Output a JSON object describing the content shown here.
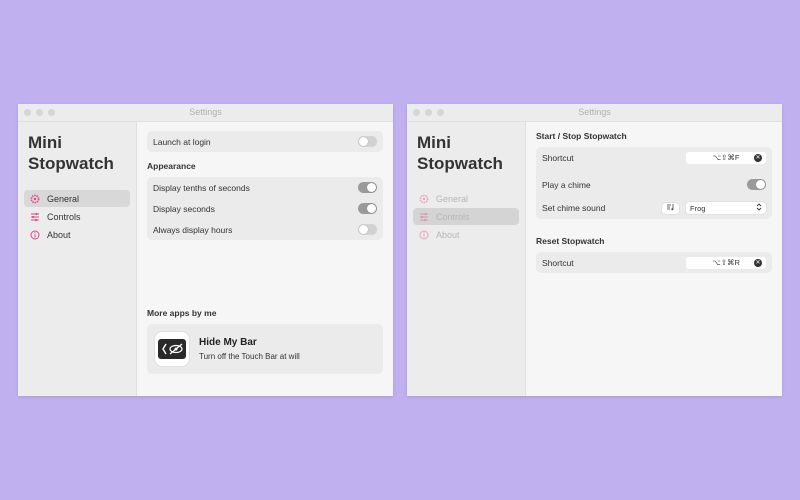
{
  "windows": [
    {
      "title": "Settings",
      "app_title_line1": "Mini",
      "app_title_line2": "Stopwatch",
      "nav": [
        {
          "label": "General",
          "icon": "gear-icon",
          "active": true
        },
        {
          "label": "Controls",
          "icon": "sliders-icon",
          "active": false
        },
        {
          "label": "About",
          "icon": "info-icon",
          "active": false
        }
      ],
      "launch_at_login": {
        "label": "Launch at login",
        "on": false
      },
      "appearance": {
        "title": "Appearance",
        "items": [
          {
            "label": "Display tenths of seconds",
            "on": true
          },
          {
            "label": "Display seconds",
            "on": true
          },
          {
            "label": "Always display hours",
            "on": false
          }
        ]
      },
      "more_apps": {
        "title": "More apps by me",
        "app_name": "Hide My Bar",
        "app_desc": "Turn off the Touch Bar at will"
      }
    },
    {
      "title": "Settings",
      "app_title_line1": "Mini",
      "app_title_line2": "Stopwatch",
      "nav": [
        {
          "label": "General",
          "icon": "gear-icon",
          "active": false
        },
        {
          "label": "Controls",
          "icon": "sliders-icon",
          "active": true
        },
        {
          "label": "About",
          "icon": "info-icon",
          "active": false
        }
      ],
      "start_stop": {
        "title": "Start / Stop Stopwatch",
        "shortcut_label": "Shortcut",
        "shortcut_value": "⌥⇧⌘F",
        "chime_label": "Play a chime",
        "chime_on": true,
        "sound_label": "Set chime sound",
        "sound_value": "Frog"
      },
      "reset": {
        "title": "Reset Stopwatch",
        "shortcut_label": "Shortcut",
        "shortcut_value": "⌥⇧⌘R"
      }
    }
  ],
  "colors": {
    "background": "#c0b0f0",
    "accent_pink": "#e0468a"
  }
}
